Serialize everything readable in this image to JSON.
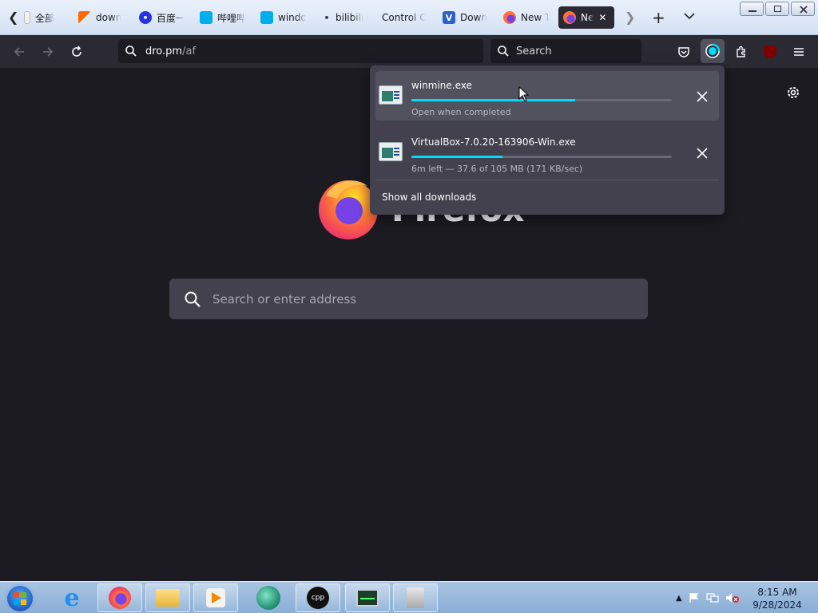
{
  "tabs": [
    {
      "title": "全部",
      "icon": "bookmark-icon",
      "color": "#e0e0e0"
    },
    {
      "title": "down",
      "icon": "orange-flag-icon",
      "color": "#ff6a00"
    },
    {
      "title": "百度一",
      "icon": "baidu-paw-icon",
      "color": "#2932e1"
    },
    {
      "title": "哔哩哔",
      "icon": "bilibili-tv-icon",
      "color": "#00aeec"
    },
    {
      "title": "windo",
      "icon": "bilibili-tv-icon",
      "color": "#00aeec"
    },
    {
      "title": "bilibili",
      "icon": "dot-icon",
      "color": "#333333"
    },
    {
      "title": "Control C",
      "icon": "none",
      "color": ""
    },
    {
      "title": "Down",
      "icon": "vs-icon",
      "color": "#2a62c9"
    },
    {
      "title": "New T",
      "icon": "firefox-icon",
      "color": "#ff7139"
    },
    {
      "title": "Ne",
      "icon": "firefox-icon",
      "color": "#ff7139"
    }
  ],
  "urlbar": {
    "host": "dro.pm",
    "path": "/af"
  },
  "searchbar": {
    "placeholder": "Search"
  },
  "downloads": {
    "items": [
      {
        "name": "winmine.exe",
        "progress": 0.63,
        "status": "Open when completed"
      },
      {
        "name": "VirtualBox-7.0.20-163906-Win.exe",
        "progress": 0.35,
        "status": "6m left — 37.6 of 105 MB (171 KB/sec)"
      }
    ],
    "show_all_label": "Show all downloads"
  },
  "newtab": {
    "wordmark": "Firefox",
    "search_placeholder": "Search or enter address"
  },
  "taskbar": {
    "time": "8:15 AM",
    "date": "9/28/2024"
  },
  "colors": {
    "accent": "#00ddff",
    "toolbar": "#2b2a33",
    "page_bg": "#1c1b22",
    "panel": "#42414d"
  }
}
